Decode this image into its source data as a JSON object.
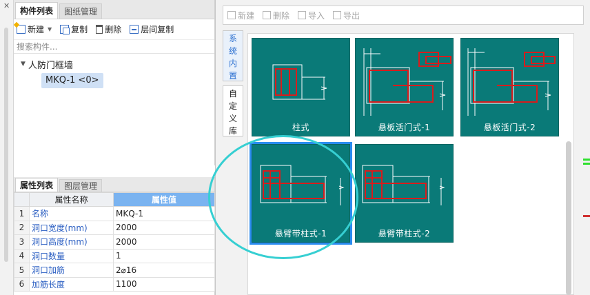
{
  "component_panel": {
    "tabs": [
      "构件列表",
      "图纸管理"
    ],
    "toolbar": {
      "new_label": "新建",
      "copy_label": "复制",
      "delete_label": "删除",
      "floor_copy_label": "层间复制"
    },
    "search_placeholder": "搜索构件...",
    "tree": {
      "root_label": "人防门框墙",
      "leaf_label": "MKQ-1 <0>"
    }
  },
  "property_panel": {
    "tabs": [
      "属性列表",
      "图层管理"
    ],
    "columns": [
      "属性名称",
      "属性值"
    ],
    "rows": [
      {
        "index": "1",
        "name": "名称",
        "value": "MKQ-1"
      },
      {
        "index": "2",
        "name": "洞口宽度(mm)",
        "value": "2000"
      },
      {
        "index": "3",
        "name": "洞口高度(mm)",
        "value": "2000"
      },
      {
        "index": "4",
        "name": "洞口数量",
        "value": "1"
      },
      {
        "index": "5",
        "name": "洞口加筋",
        "value": "2⌀16"
      },
      {
        "index": "6",
        "name": "加筋长度",
        "value": "1100"
      }
    ]
  },
  "dialog": {
    "toolbar": {
      "new_label": "新建",
      "delete_label": "删除",
      "import_label": "导入",
      "export_label": "导出"
    },
    "side_tabs": {
      "system": [
        "系",
        "统",
        "内",
        "置"
      ],
      "custom": [
        "自",
        "定",
        "义",
        "库"
      ]
    },
    "tiles": [
      {
        "label": "柱式"
      },
      {
        "label": "悬板活门式-1"
      },
      {
        "label": "悬板活门式-2"
      },
      {
        "label": "悬臂带柱式-1"
      },
      {
        "label": "悬臂带柱式-2"
      }
    ],
    "selected_tile": "悬臂带柱式-1"
  },
  "colors": {
    "tile_bg": "#0a7a78",
    "rebar_red": "#d81c1c",
    "selection_blue": "#2a8cf0",
    "highlight_cyan": "#36cfd2",
    "header_blue": "#7ab3f0"
  },
  "icons": {
    "new": "new-doc-icon",
    "copy": "copy-icon",
    "delete": "trash-icon",
    "floor_copy": "floor-copy-icon",
    "import": "import-icon",
    "export": "export-icon"
  }
}
